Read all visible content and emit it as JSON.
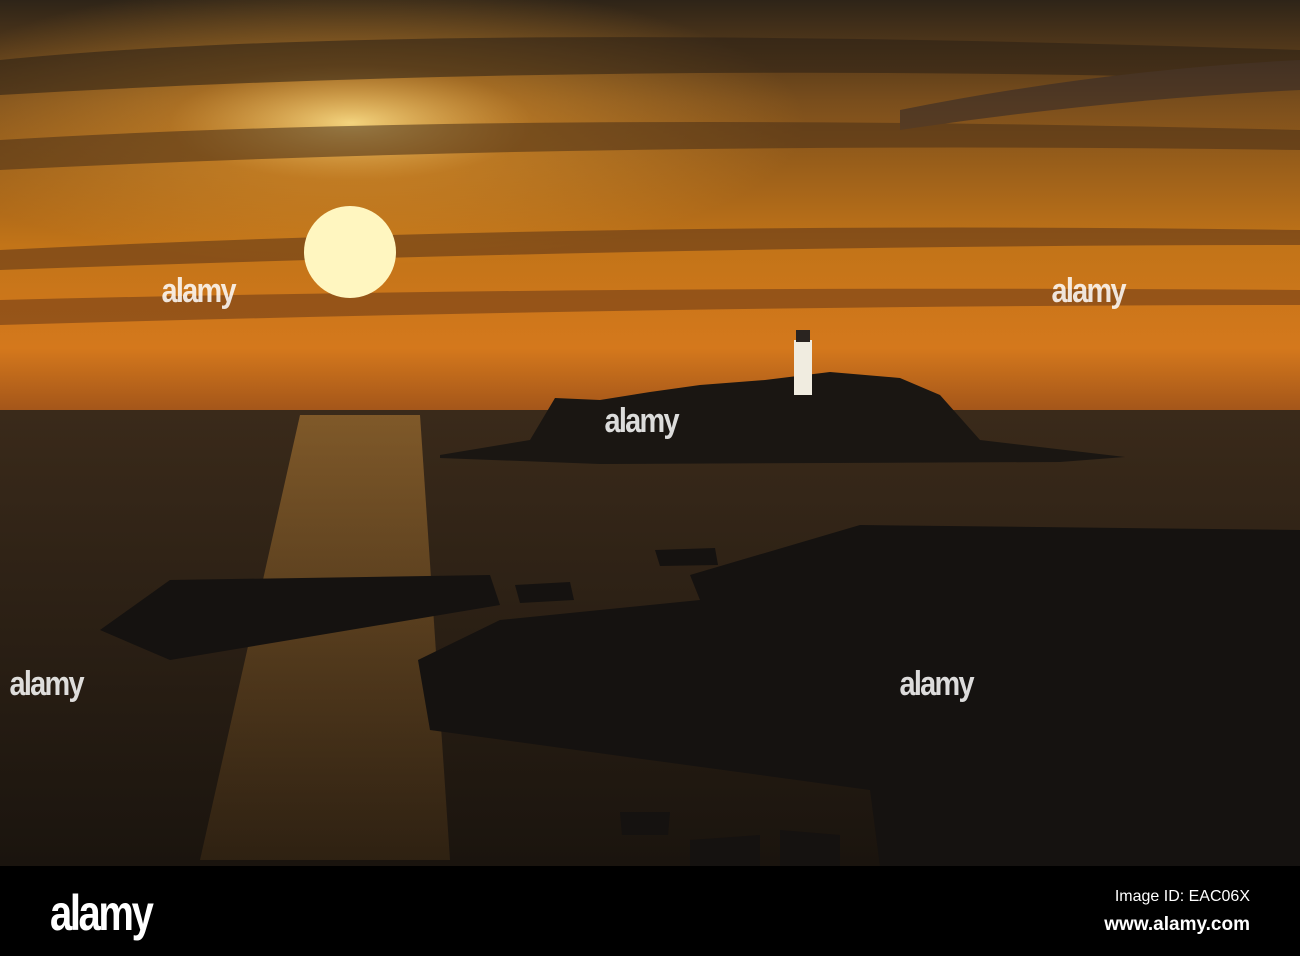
{
  "watermark": {
    "text": "alamy"
  },
  "footer": {
    "logo": "alamy",
    "image_id": "Image ID: EAC06X",
    "url": "www.alamy.com"
  },
  "colors": {
    "sky_top": "#3a2a18",
    "sky_glow": "#e08a1c",
    "sun": "#fff6c0",
    "sea": "#1c1610",
    "rock": "#141210"
  }
}
